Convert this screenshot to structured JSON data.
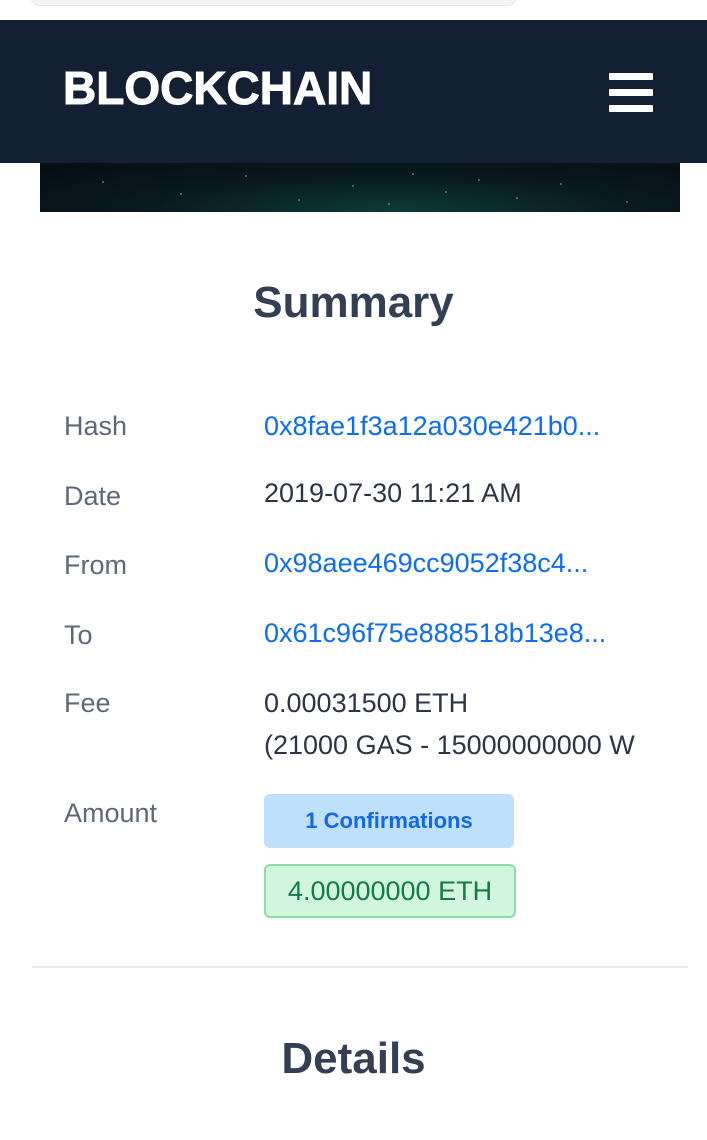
{
  "header": {
    "brand": "BLOCKCHAIN",
    "menu_icon": "hamburger-menu-icon"
  },
  "summary": {
    "title": "Summary",
    "rows": {
      "hash": {
        "label": "Hash",
        "value": "0x8fae1f3a12a030e421b0..."
      },
      "date": {
        "label": "Date",
        "value": "2019-07-30 11:21 AM"
      },
      "from": {
        "label": "From",
        "value": "0x98aee469cc9052f38c4..."
      },
      "to": {
        "label": "To",
        "value": "0x61c96f75e888518b13e8..."
      },
      "fee": {
        "label": "Fee",
        "value": "0.00031500 ETH",
        "detail": "(21000 GAS - 15000000000 W"
      },
      "amount": {
        "label": "Amount",
        "confirmations": "1 Confirmations",
        "value": "4.00000000 ETH"
      }
    }
  },
  "details": {
    "title": "Details"
  },
  "colors": {
    "header_bg": "#131f33",
    "link": "#0c6cf2",
    "confirm_bg": "#bfe0fb",
    "confirm_text": "#1268e8",
    "amount_bg": "#d2f5dd",
    "amount_text": "#117c46"
  }
}
